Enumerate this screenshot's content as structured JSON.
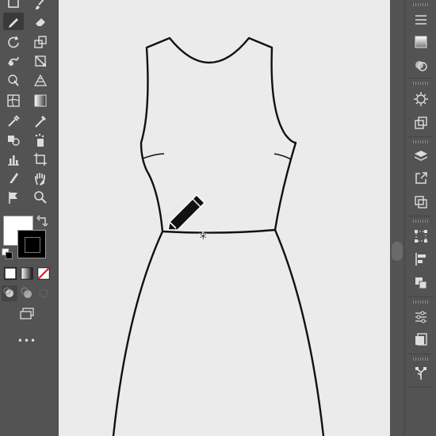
{
  "toolbar": {
    "tools": [
      {
        "id": "rectangle-tool",
        "icon": "rectangle-icon"
      },
      {
        "id": "paintbrush-tool",
        "icon": "paintbrush-icon"
      },
      {
        "id": "pencil-tool",
        "icon": "pencil-icon",
        "active": true
      },
      {
        "id": "eraser-tool",
        "icon": "eraser-icon"
      },
      {
        "id": "rotate-tool",
        "icon": "rotate-icon"
      },
      {
        "id": "scale-tool",
        "icon": "scale-icon"
      },
      {
        "id": "warp-tool",
        "icon": "warp-icon"
      },
      {
        "id": "free-transform-tool",
        "icon": "free-transform-icon"
      },
      {
        "id": "shape-builder-tool",
        "icon": "shape-builder-icon"
      },
      {
        "id": "perspective-grid-tool",
        "icon": "perspective-grid-icon"
      },
      {
        "id": "mesh-tool",
        "icon": "mesh-icon"
      },
      {
        "id": "gradient-tool",
        "icon": "gradient-icon"
      },
      {
        "id": "eyedropper-tool",
        "icon": "eyedropper-icon"
      },
      {
        "id": "measure-tool",
        "icon": "measure-icon"
      },
      {
        "id": "blend-tool",
        "icon": "blend-icon"
      },
      {
        "id": "symbol-sprayer-tool",
        "icon": "symbol-sprayer-icon"
      },
      {
        "id": "column-graph-tool",
        "icon": "column-graph-icon"
      },
      {
        "id": "artboard-tool",
        "icon": "artboard-icon"
      },
      {
        "id": "slice-tool",
        "icon": "slice-icon"
      },
      {
        "id": "hand-tool",
        "icon": "hand-icon"
      },
      {
        "id": "puppet-warp-tool",
        "icon": "puppet-warp-icon"
      },
      {
        "id": "zoom-tool",
        "icon": "zoom-icon"
      }
    ],
    "fill_color": "#ffffff",
    "stroke_color": "#000000",
    "more_tools_label": "•••"
  },
  "right_panel": {
    "icons": [
      "properties-icon",
      "swatches-icon",
      "transparency-icon",
      "appearance-icon",
      "symbols-icon",
      "layers-icon",
      "export-icon",
      "pathfinder-icon",
      "align-icon",
      "transform-icon",
      "align-left-icon",
      "pathfinder-unite-icon",
      "adjustments-icon",
      "artboards-icon",
      "libraries-icon"
    ]
  },
  "colors": {
    "ui_bg": "#535353",
    "artboard": "#ebebeb",
    "active_tool": "#3a3a3a",
    "stroke": "#111111"
  }
}
